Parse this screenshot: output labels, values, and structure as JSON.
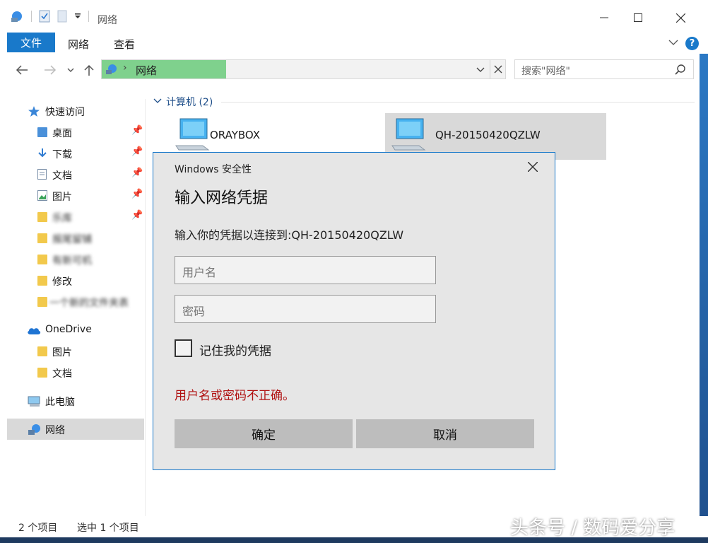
{
  "window": {
    "title": "网络"
  },
  "ribbon": {
    "file_tab": "文件",
    "tabs": [
      "网络",
      "查看"
    ],
    "help": "?"
  },
  "navigation": {
    "address_label": "网络",
    "search_placeholder": "搜索\"网络\""
  },
  "sidebar": {
    "quick_access": "快速访问",
    "quick_items": [
      "桌面",
      "下载",
      "文档",
      "图片",
      "乐库",
      "报尾留铺",
      "有新可机",
      "修改",
      "一个新的文件夹表"
    ],
    "onedrive": "OneDrive",
    "onedrive_items": [
      "图片",
      "文档"
    ],
    "this_pc": "此电脑",
    "network": "网络"
  },
  "content": {
    "group_title": "计算机 (2)",
    "computers": [
      "ORAYBOX",
      "QH-20150420QZLW"
    ]
  },
  "status": {
    "item_count": "2 个项目",
    "selected": "选中 1 个项目"
  },
  "dialog": {
    "caption": "Windows 安全性",
    "heading": "输入网络凭据",
    "message": "输入你的凭据以连接到:QH-20150420QZLW",
    "username_placeholder": "用户名",
    "password_placeholder": "密码",
    "remember_label": "记住我的凭据",
    "error": "用户名或密码不正确。",
    "ok_label": "确定",
    "cancel_label": "取消",
    "error_color": "#b01010",
    "accent_color": "#1979ca"
  },
  "watermark": "头条号 / 数码爱分享"
}
